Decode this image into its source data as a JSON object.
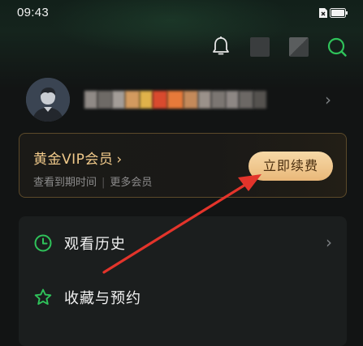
{
  "status_bar": {
    "time": "09:43"
  },
  "vip": {
    "title": "黄金VIP会员",
    "arrow": "›",
    "check_expiry": "查看到期时间",
    "more_members": "更多会员",
    "renew_label": "立即续费"
  },
  "menu": {
    "items": [
      {
        "label": "观看历史",
        "icon": "clock-icon"
      },
      {
        "label": "收藏与预约",
        "icon": "star-icon"
      }
    ]
  },
  "colors": {
    "accent_green": "#2fc35a",
    "vip_gold": "#f0c98a",
    "renew_button": "#f0c78f",
    "annotation_red": "#e3342b"
  }
}
